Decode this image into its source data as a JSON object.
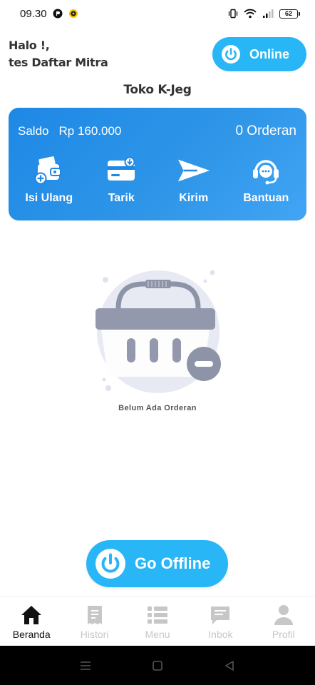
{
  "status_bar": {
    "time": "09.30",
    "battery": "62"
  },
  "header": {
    "greeting_line1": "Halo !,",
    "greeting_line2": "tes Daftar Mitra",
    "online_label": "Online",
    "store_name": "Toko K-Jeg"
  },
  "wallet": {
    "balance_label": "Saldo",
    "balance_value": "Rp 160.000",
    "order_count": "0 Orderan",
    "actions": [
      {
        "label": "Isi Ulang",
        "icon": "wallet-add-icon"
      },
      {
        "label": "Tarik",
        "icon": "withdraw-card-icon"
      },
      {
        "label": "Kirim",
        "icon": "send-icon"
      },
      {
        "label": "Bantuan",
        "icon": "headset-icon"
      }
    ]
  },
  "empty_state": {
    "message": "Belum Ada Orderan"
  },
  "offline_button": {
    "label": "Go Offline"
  },
  "bottom_nav": {
    "items": [
      {
        "label": "Beranda",
        "icon": "home-icon",
        "active": true
      },
      {
        "label": "Histori",
        "icon": "receipt-icon",
        "active": false
      },
      {
        "label": "Menu",
        "icon": "menu-list-icon",
        "active": false
      },
      {
        "label": "Inbok",
        "icon": "chat-icon",
        "active": false
      },
      {
        "label": "Profil",
        "icon": "user-icon",
        "active": false
      }
    ]
  },
  "colors": {
    "accent": "#29b6f6",
    "card": "#2196f3",
    "nav_active": "#111111",
    "nav_inactive": "#c7c7c7"
  }
}
